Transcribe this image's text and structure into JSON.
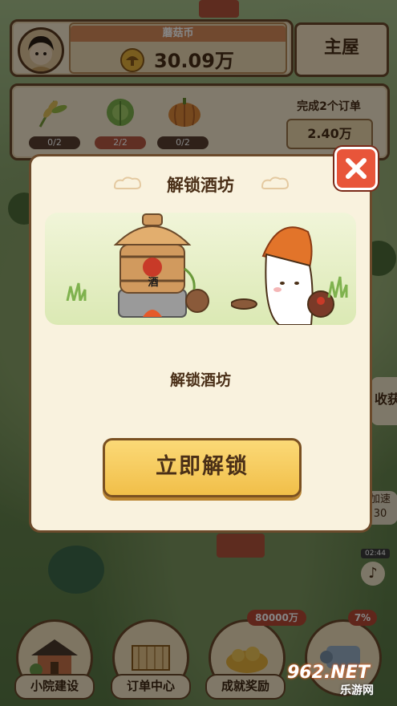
{
  "top_bar": {
    "coin_label": "蘑菇币",
    "coin_value": "30.09万",
    "home_button": "主屋"
  },
  "orders": {
    "crops": [
      {
        "icon": "wheat-icon",
        "count": "0/2"
      },
      {
        "icon": "cabbage-icon",
        "count": "2/2"
      },
      {
        "icon": "pumpkin-icon",
        "count": "0/2"
      }
    ],
    "complete_label": "完成2个订单",
    "reward_value": "2.40万"
  },
  "dialog": {
    "title": "解锁酒坊",
    "wine_sign": "酒",
    "description": "解锁酒坊",
    "unlock_button": "立即解锁"
  },
  "side": {
    "harvest_label": "收获",
    "speed_label": "加速",
    "speed_value": "30",
    "timer": "02:44"
  },
  "bottom_nav": {
    "items": [
      {
        "label": "小院建设"
      },
      {
        "label": "订单中心"
      },
      {
        "label": "成就奖励",
        "badge": "80000万"
      },
      {
        "label": "",
        "badge": "7%"
      }
    ]
  },
  "watermark": {
    "brand": "962.NET",
    "sub": "乐游网"
  },
  "colors": {
    "accent": "#f1bf49",
    "close": "#e8553a",
    "text": "#4a2f17",
    "panel": "#f7ead0"
  }
}
